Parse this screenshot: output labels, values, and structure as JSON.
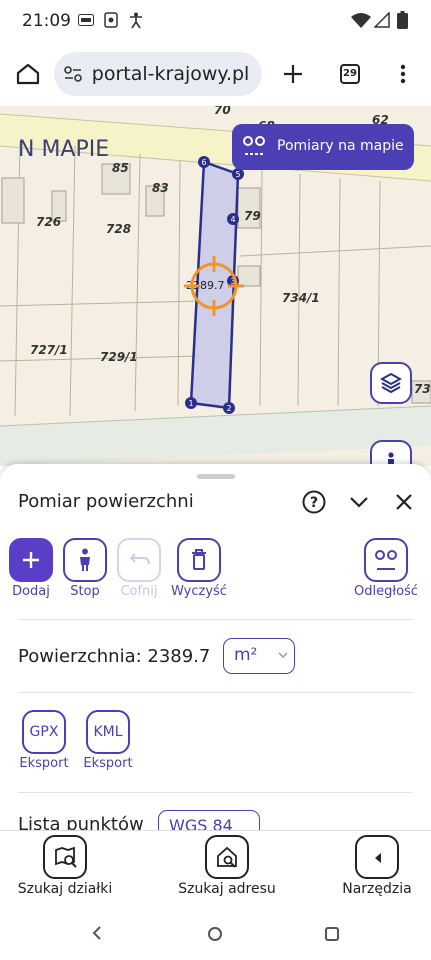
{
  "status": {
    "time": "21:09",
    "left_icons": [
      "vpn-icon",
      "screen-record-icon",
      "accessibility-icon"
    ],
    "right_icons": [
      "wifi-icon",
      "signal-icon",
      "battery-icon"
    ]
  },
  "browser": {
    "url": "geoportal-krajowy.pl",
    "url_visible": " portal-krajowy.pl",
    "tab_count": "29"
  },
  "map": {
    "parcel_labels": [
      "70",
      "68",
      "62",
      "85",
      "83",
      "726",
      "728",
      "79",
      "734/1",
      "727/1",
      "729/1",
      "73"
    ],
    "corner_labels": [
      "6",
      "5",
      "4",
      "3",
      "1",
      "2"
    ],
    "area_label": "2389.7 ",
    "logo_text": "N MAPIE",
    "measure_button": "Pomiary na mapie"
  },
  "sheet": {
    "title": "Pomiar powierzchni",
    "tools": [
      {
        "label": "Dodaj",
        "icon": "plus-icon",
        "state": "primary"
      },
      {
        "label": "Stop",
        "icon": "walking-person-icon",
        "state": "normal"
      },
      {
        "label": "Cofnij",
        "icon": "undo-icon",
        "state": "disabled"
      },
      {
        "label": "Wyczyść",
        "icon": "trash-icon",
        "state": "normal"
      }
    ],
    "distance_tool": {
      "label": "Odległość",
      "icon": "distance-icon"
    },
    "area_label": "Powierzchnia: 2389.7",
    "unit": "m²",
    "exports": [
      {
        "badge": "GPX",
        "label": "Eksport"
      },
      {
        "badge": "KML",
        "label": "Eksport"
      }
    ],
    "points_label": "Lista punktów",
    "crs": "WGS 84"
  },
  "bottom_nav": [
    {
      "label": "Szukaj działki",
      "icon": "map-search-icon"
    },
    {
      "label": "Szukaj adresu",
      "icon": "home-search-icon"
    },
    {
      "label": "Narzędzia",
      "icon": "chevron-left-icon"
    }
  ],
  "colors": {
    "accent": "#4a3fb3",
    "primary_button": "#5a3ec8",
    "crosshair": "#f0952a",
    "parcel_fill": "#c7c8ea"
  }
}
